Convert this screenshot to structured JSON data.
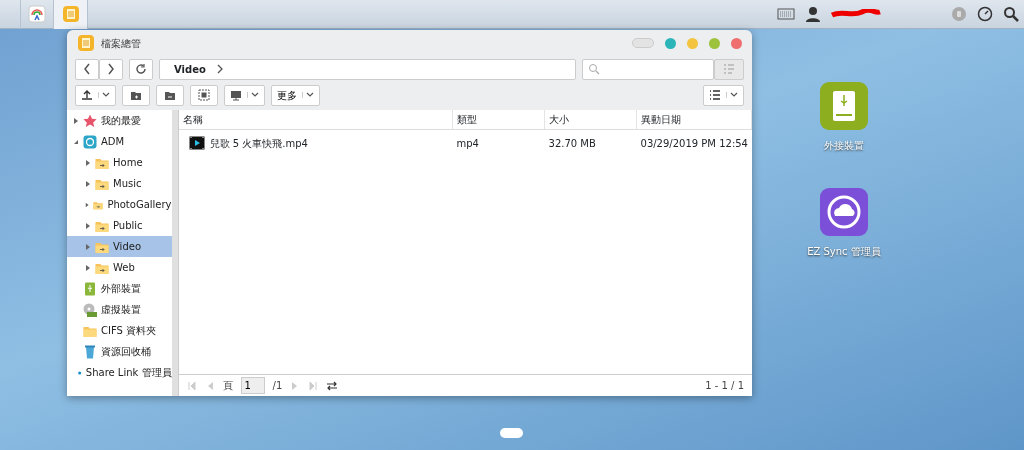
{
  "taskbar": {
    "apps": [
      {
        "kind": "launcher",
        "selected": false
      },
      {
        "kind": "files",
        "selected": true
      }
    ]
  },
  "window": {
    "title": "檔案總管"
  },
  "toolbar": {
    "path": "Video",
    "more_button": "更多"
  },
  "sidebar": {
    "items": [
      {
        "label": "我的最愛",
        "kind": "star",
        "expanded": false,
        "selected": false
      },
      {
        "label": "ADM",
        "kind": "adm",
        "expanded": true,
        "selected": false,
        "children": [
          {
            "label": "Home",
            "kind": "share",
            "expanded": false,
            "selected": false
          },
          {
            "label": "Music",
            "kind": "share",
            "expanded": false,
            "selected": false
          },
          {
            "label": "PhotoGallery",
            "kind": "share",
            "expanded": false,
            "selected": false
          },
          {
            "label": "Public",
            "kind": "share",
            "expanded": false,
            "selected": false
          },
          {
            "label": "Video",
            "kind": "share",
            "expanded": false,
            "selected": true
          },
          {
            "label": "Web",
            "kind": "share",
            "expanded": false,
            "selected": false
          }
        ]
      },
      {
        "label": "外部裝置",
        "kind": "usb",
        "selected": false
      },
      {
        "label": "虛擬裝置",
        "kind": "disc",
        "selected": false
      },
      {
        "label": "CIFS 資料夾",
        "kind": "folder",
        "selected": false
      },
      {
        "label": "資源回收桶",
        "kind": "recycle",
        "selected": false
      },
      {
        "label": "Share Link 管理員",
        "kind": "link",
        "selected": false
      }
    ]
  },
  "table": {
    "columns": [
      "名稱",
      "類型",
      "大小",
      "異動日期"
    ],
    "rows": [
      {
        "name": "兒歌 5 火車快飛.mp4",
        "type": "mp4",
        "size": "32.70 MB",
        "modified": "03/29/2019 PM 12:54",
        "selected": false
      }
    ]
  },
  "pager": {
    "page_label": "頁",
    "page": "1",
    "total": "/1",
    "range": "1 - 1 / 1"
  },
  "desktop_icons": [
    {
      "label": "外接裝置",
      "kind": "usb"
    },
    {
      "label": "EZ Sync 管理員",
      "kind": "sync"
    }
  ]
}
